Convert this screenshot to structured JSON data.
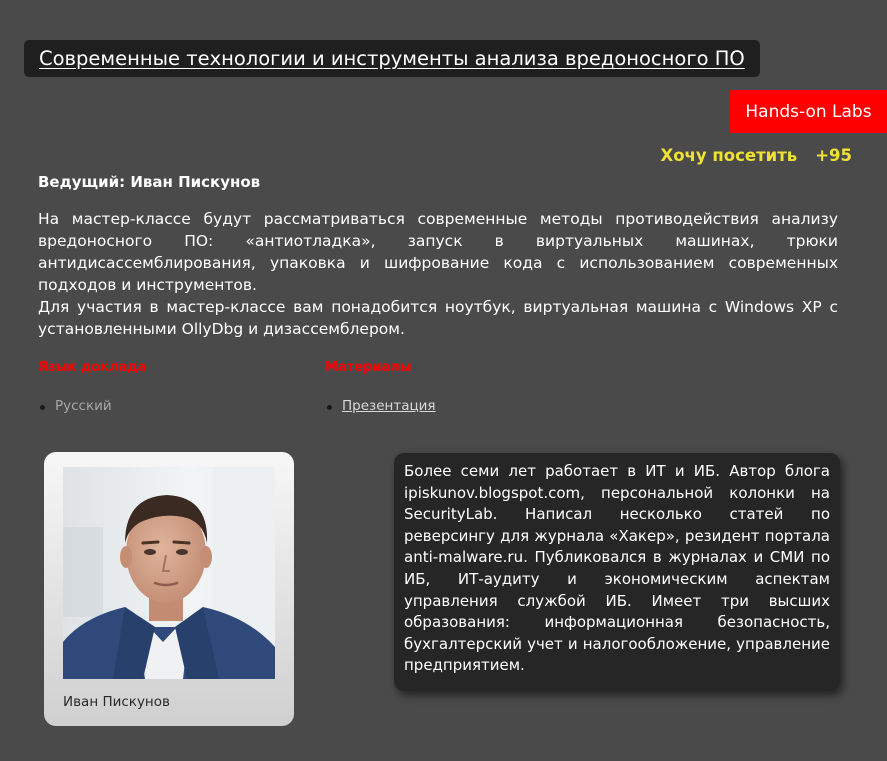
{
  "event": {
    "title": "Современные технологии и инструменты анализа вредоносного ПО",
    "format_badge": "Hands-on Labs",
    "visit_label": "Хочу посетить",
    "visit_count": "+95",
    "speaker_line": "Ведущий: Иван Пискунов",
    "description": [
      "На мастер-классе будут рассматриваться современные методы противодействия анализу вредоносного ПО: «антиотладка», запуск в виртуальных машинах, трюки антидисассемблирования, упаковка и шифрование кода с использованием современных подходов и инструментов.",
      "Для участия в мастер-классе вам понадобится ноутбук, виртуальная машина с Windows XP с установленными OllyDbg и дизассемблером."
    ]
  },
  "meta": {
    "language": {
      "heading": "Язык доклада",
      "items": [
        "Русский"
      ]
    },
    "materials": {
      "heading": "Материалы",
      "items": [
        "Презентация"
      ]
    }
  },
  "speaker": {
    "name": "Иван Пискунов",
    "bio": "Более семи лет работает в ИТ и ИБ. Автор блога ipiskunov.blogspot.com, персональной колонки на SecurityLab. Написал несколько статей по реверсингу для журнала «Хакер», резидент портала anti-malware.ru. Публиковался в журналах и СМИ по ИБ, ИТ-аудиту и экономическим аспектам управления службой ИБ. Имеет три высших образования: информационная безопасность, бухгалтерский учет и налогообложение, управление предприятием."
  },
  "colors": {
    "background": "#4a4a4a",
    "badge": "#ff0000",
    "visit": "#f0e232",
    "meta_heading": "#ff0000"
  }
}
